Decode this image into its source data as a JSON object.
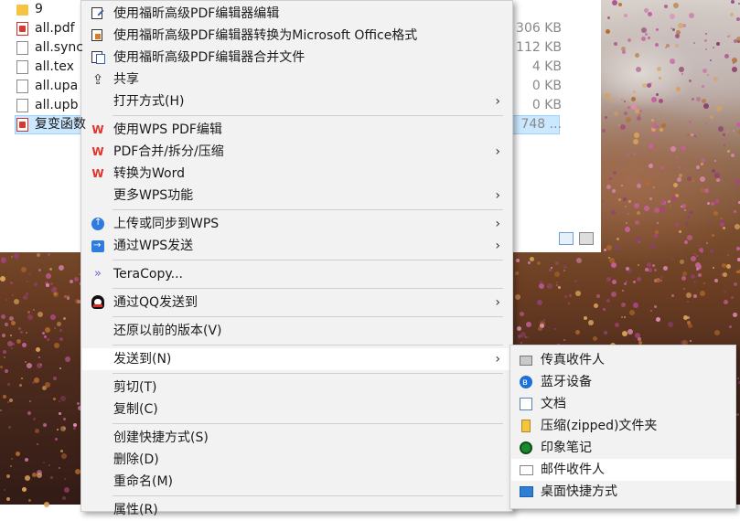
{
  "explorer": {
    "files": [
      {
        "name": "9",
        "size": "",
        "icon": "folder-icon",
        "selected": false
      },
      {
        "name": "all.pdf",
        "size": "306 KB",
        "icon": "pdf-file-icon",
        "selected": false
      },
      {
        "name": "all.sync",
        "size": "112 KB",
        "icon": "document-file-icon",
        "selected": false
      },
      {
        "name": "all.tex",
        "size": "4 KB",
        "icon": "document-file-icon",
        "selected": false
      },
      {
        "name": "all.upa",
        "size": "0 KB",
        "icon": "document-file-icon",
        "selected": false
      },
      {
        "name": "all.upb",
        "size": "0 KB",
        "icon": "document-file-icon",
        "selected": false
      },
      {
        "name": "复变函数",
        "size": "748 ...",
        "icon": "pdf-file-icon",
        "selected": true
      }
    ]
  },
  "context_menu": {
    "items": [
      {
        "label": "使用福昕高级PDF编辑器编辑",
        "icon": "pdf-edit-icon",
        "submenu": false
      },
      {
        "label": "使用福昕高级PDF编辑器转换为Microsoft Office格式",
        "icon": "office-convert-icon",
        "submenu": false
      },
      {
        "label": "使用福昕高级PDF编辑器合并文件",
        "icon": "merge-files-icon",
        "submenu": false
      },
      {
        "label": "共享",
        "icon": "share-icon",
        "submenu": false
      },
      {
        "label": "打开方式(H)",
        "icon": "",
        "submenu": true
      },
      {
        "label": "使用WPS PDF编辑",
        "icon": "wps-icon",
        "submenu": false
      },
      {
        "label": "PDF合并/拆分/压缩",
        "icon": "wps-icon",
        "submenu": true
      },
      {
        "label": "转换为Word",
        "icon": "wps-icon",
        "submenu": false
      },
      {
        "label": "更多WPS功能",
        "icon": "",
        "submenu": true
      },
      {
        "label": "上传或同步到WPS",
        "icon": "cloud-upload-icon",
        "submenu": true
      },
      {
        "label": "通过WPS发送",
        "icon": "send-icon",
        "submenu": true
      },
      {
        "label": "TeraCopy...",
        "icon": "teracopy-icon",
        "submenu": false
      },
      {
        "label": "通过QQ发送到",
        "icon": "qq-icon",
        "submenu": true
      },
      {
        "label": "还原以前的版本(V)",
        "icon": "",
        "submenu": false
      },
      {
        "label": "发送到(N)",
        "icon": "",
        "submenu": true
      },
      {
        "label": "剪切(T)",
        "icon": "",
        "submenu": false
      },
      {
        "label": "复制(C)",
        "icon": "",
        "submenu": false
      },
      {
        "label": "创建快捷方式(S)",
        "icon": "",
        "submenu": false
      },
      {
        "label": "删除(D)",
        "icon": "",
        "submenu": false
      },
      {
        "label": "重命名(M)",
        "icon": "",
        "submenu": false
      },
      {
        "label": "属性(R)",
        "icon": "",
        "submenu": false
      }
    ]
  },
  "send_to_menu": {
    "items": [
      {
        "label": "传真收件人",
        "icon": "fax-icon"
      },
      {
        "label": "蓝牙设备",
        "icon": "bluetooth-icon"
      },
      {
        "label": "文档",
        "icon": "documents-icon"
      },
      {
        "label": "压缩(zipped)文件夹",
        "icon": "zip-folder-icon"
      },
      {
        "label": "印象笔记",
        "icon": "evernote-icon"
      },
      {
        "label": "邮件收件人",
        "icon": "mail-icon"
      },
      {
        "label": "桌面快捷方式",
        "icon": "desktop-icon"
      }
    ]
  },
  "colors": {
    "menu_bg": "#f2f2f2",
    "hover_bg": "#ffffff",
    "selection": "#cce8ff",
    "wps_red": "#e0332a"
  }
}
